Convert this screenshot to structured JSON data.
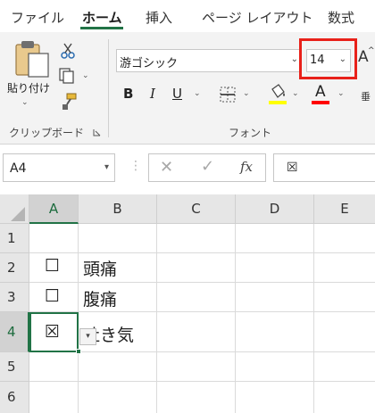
{
  "ribbon_tabs": [
    "ファイル",
    "ホーム",
    "挿入",
    "ページ レイアウト",
    "数式"
  ],
  "clipboard": {
    "paste_label": "貼り付け",
    "group_label": "クリップボード"
  },
  "font_group": {
    "font_name": "游ゴシック",
    "font_size": "14",
    "group_label": "フォント",
    "bold": "B",
    "italic": "I",
    "underline": "U",
    "font_color_letter": "A",
    "grow_letter": "A",
    "truncated_label": "垂"
  },
  "colors": {
    "accent": "#217346",
    "highlight_box": "#e8211a",
    "fill_yellow": "#ffff00",
    "font_red": "#ff0000"
  },
  "formula_bar": {
    "name_box": "A4",
    "content": "☒",
    "fx": "fx"
  },
  "columns": [
    "A",
    "B",
    "C",
    "D",
    "E"
  ],
  "rows": [
    "1",
    "2",
    "3",
    "4",
    "5",
    "6"
  ],
  "cells": {
    "A2": "☐",
    "B2": "頭痛",
    "A3": "☐",
    "B3": "腹痛",
    "A4": "☒",
    "B4": "吐き気"
  }
}
